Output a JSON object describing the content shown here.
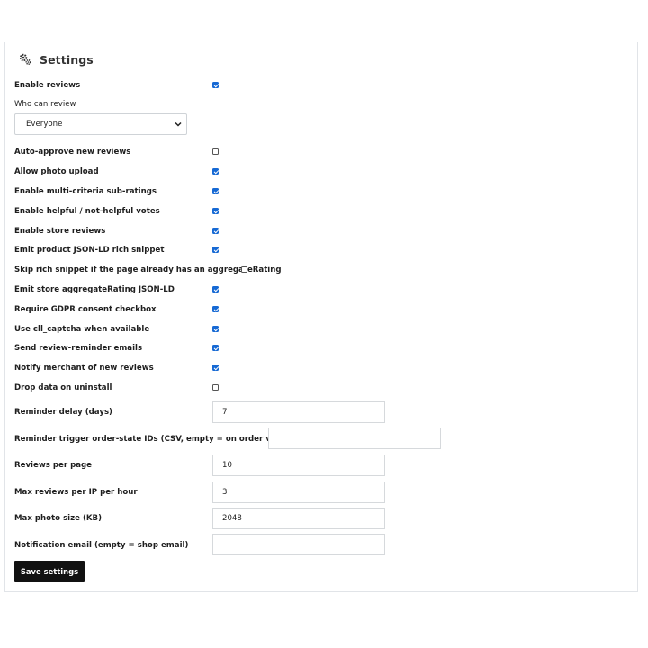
{
  "header": {
    "title": "Settings",
    "icon": "gears-icon"
  },
  "fields": {
    "enable_reviews": {
      "label": "Enable reviews",
      "checked": true
    },
    "who_can_review": {
      "label": "Who can review",
      "value": "Everyone"
    },
    "auto_approve": {
      "label": "Auto-approve new reviews",
      "checked": false
    },
    "photo_upload": {
      "label": "Allow photo upload",
      "checked": true
    },
    "multi_criteria": {
      "label": "Enable multi-criteria sub-ratings",
      "checked": true
    },
    "helpful_votes": {
      "label": "Enable helpful / not-helpful votes",
      "checked": true
    },
    "store_reviews": {
      "label": "Enable store reviews",
      "checked": true
    },
    "product_jsonld": {
      "label": "Emit product JSON-LD rich snippet",
      "checked": true
    },
    "skip_rich_snippet": {
      "label": "Skip rich snippet if the page already has an aggregateRating",
      "checked": false
    },
    "store_jsonld": {
      "label": "Emit store aggregateRating JSON-LD",
      "checked": true
    },
    "gdpr": {
      "label": "Require GDPR consent checkbox",
      "checked": true
    },
    "captcha": {
      "label": "Use cll_captcha when available",
      "checked": true
    },
    "reminder_emails": {
      "label": "Send review-reminder emails",
      "checked": true
    },
    "notify_merchant": {
      "label": "Notify merchant of new reviews",
      "checked": true
    },
    "drop_data": {
      "label": "Drop data on uninstall",
      "checked": false
    },
    "reminder_delay": {
      "label": "Reminder delay (days)",
      "value": "7"
    },
    "reminder_trigger": {
      "label": "Reminder trigger order-state IDs (CSV, empty = on order validation)",
      "value": ""
    },
    "reviews_per_page": {
      "label": "Reviews per page",
      "value": "10"
    },
    "max_reviews_ip": {
      "label": "Max reviews per IP per hour",
      "value": "3"
    },
    "max_photo_size": {
      "label": "Max photo size (KB)",
      "value": "2048"
    },
    "notification_email": {
      "label": "Notification email (empty = shop email)",
      "value": ""
    }
  },
  "actions": {
    "save_label": "Save settings"
  },
  "colors": {
    "accent": "#1669d4",
    "button_bg": "#111111"
  }
}
